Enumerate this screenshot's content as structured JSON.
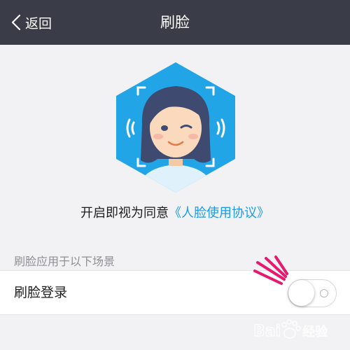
{
  "nav": {
    "back_label": "返回",
    "title": "刷脸",
    "background": "#3a3d47"
  },
  "hero": {
    "icon": "face-scan-avatar-icon",
    "color": "#22a5e7"
  },
  "agreement": {
    "prefix": "开启即视为同意",
    "link": "《人脸使用协议》",
    "link_color": "#1a9be6"
  },
  "section": {
    "label": "刷脸应用于以下场景"
  },
  "settings": [
    {
      "label": "刷脸登录",
      "enabled": false
    }
  ],
  "decorations": {
    "accent_icon": "burst-lines-icon",
    "accent_color": "#e8186e"
  },
  "watermark": {
    "text": "Bai 经验",
    "icon": "baidu-paw-icon"
  }
}
